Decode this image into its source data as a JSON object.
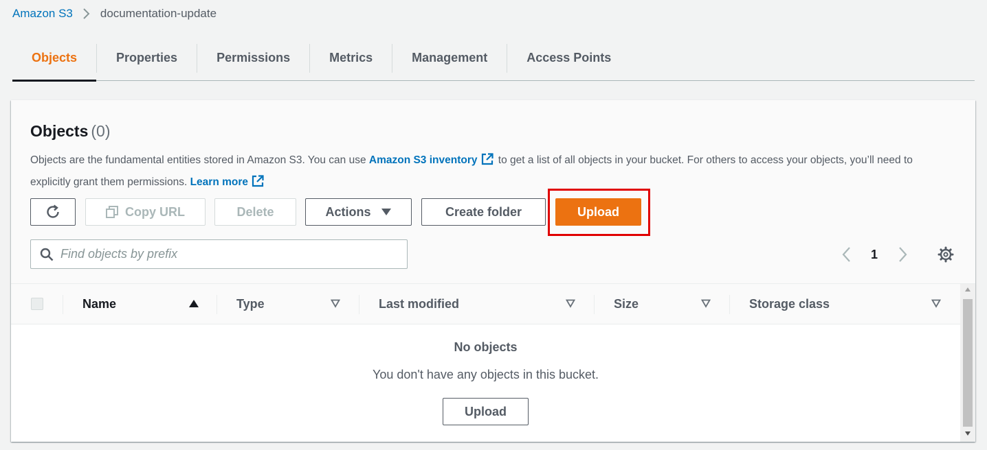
{
  "breadcrumb": {
    "root": "Amazon S3",
    "current": "documentation-update"
  },
  "tabs": [
    {
      "label": "Objects",
      "active": true
    },
    {
      "label": "Properties"
    },
    {
      "label": "Permissions"
    },
    {
      "label": "Metrics"
    },
    {
      "label": "Management"
    },
    {
      "label": "Access Points"
    }
  ],
  "objects": {
    "title": "Objects",
    "count": "(0)",
    "description_part1": "Objects are the fundamental entities stored in Amazon S3. You can use ",
    "inventory_link": "Amazon S3 inventory",
    "description_part2": " to get a list of all objects in your bucket. For others to access your objects, you’ll need to explicitly grant them permissions. ",
    "learn_more_link": "Learn more"
  },
  "toolbar": {
    "copy_url": "Copy URL",
    "delete": "Delete",
    "actions": "Actions",
    "create_folder": "Create folder",
    "upload": "Upload"
  },
  "search": {
    "placeholder": "Find objects by prefix"
  },
  "pagination": {
    "page": "1"
  },
  "table": {
    "columns": [
      "Name",
      "Type",
      "Last modified",
      "Size",
      "Storage class"
    ]
  },
  "empty_state": {
    "title": "No objects",
    "message": "You don't have any objects in this bucket.",
    "button": "Upload"
  },
  "colors": {
    "accent": "#ec7211",
    "link": "#0073bb",
    "highlight": "#e00000"
  }
}
